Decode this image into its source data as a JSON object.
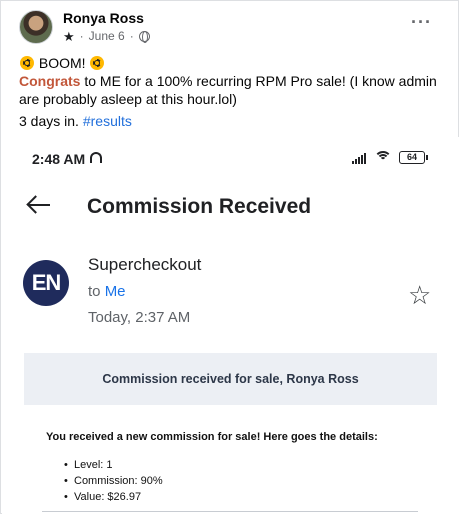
{
  "post": {
    "author": "Ronya Ross",
    "date": "June 6",
    "separator": "·",
    "more_label": "···",
    "line1": "BOOM!",
    "mention": "Congrats",
    "line2_rest": " to ME for a 100% recurring RPM Pro sale! (I know admin are probably asleep at this hour.lol)",
    "line3_prefix": "3 days in. ",
    "hashtag": "#results"
  },
  "phone": {
    "status_time": "2:48 AM",
    "battery": "64",
    "title": "Commission Received",
    "sender_initials": "EN",
    "sender": "Supercheckout",
    "to_prefix": "to ",
    "to_recipient": "Me",
    "received": "Today, 2:37 AM",
    "star_glyph": "☆",
    "banner": "Commission received for sale, Ronya Ross",
    "lead": "You received a new commission for sale! Here goes the details:",
    "details": [
      "Level: 1",
      "Commission: 90%",
      "Value: $26.97"
    ]
  },
  "colors": {
    "mention": "#c2573a",
    "hashtag": "#216fdb",
    "recipient": "#1a73e8",
    "sender_avatar": "#1f2b5c",
    "banner_bg": "#eceff4"
  },
  "icons": [
    "profile-photo",
    "top-fan-star-icon",
    "globe-icon",
    "radioactive-emoji-icon",
    "headphone-icon",
    "signal-icon",
    "wifi-icon",
    "battery-icon",
    "back-arrow-icon",
    "star-outline-icon"
  ]
}
